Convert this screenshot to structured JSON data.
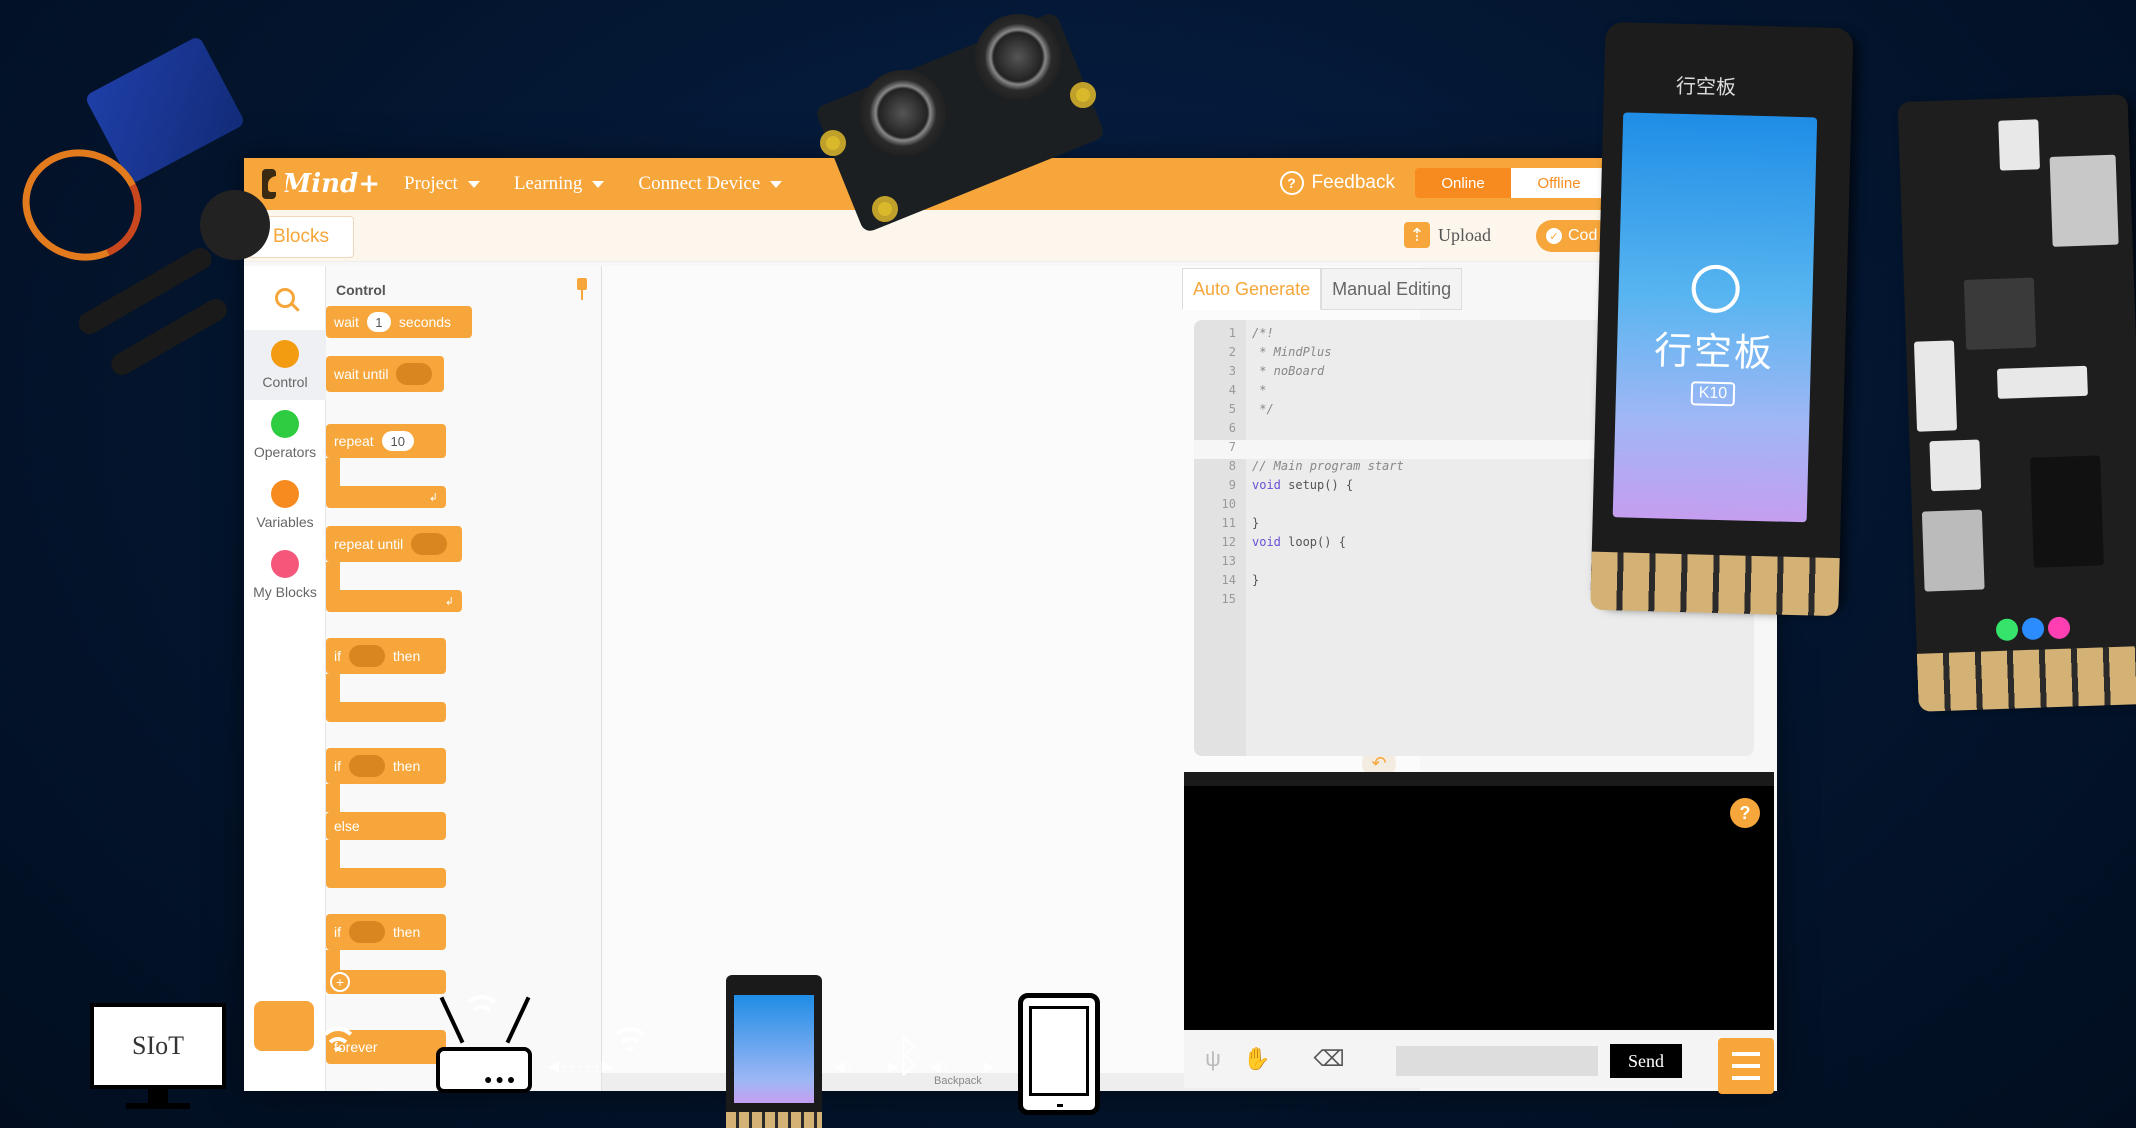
{
  "app": {
    "logo_text": "Mind+",
    "menu": [
      {
        "label": "Project"
      },
      {
        "label": "Learning"
      },
      {
        "label": "Connect Device"
      }
    ],
    "feedback_label": "Feedback",
    "mode_online": "Online",
    "mode_offline": "Offline",
    "accent_color": "#f6a63a"
  },
  "toolbar": {
    "blocks_tab": "Blocks",
    "upload_label": "Upload",
    "code_button": "Cod"
  },
  "categories": [
    {
      "label": "Control",
      "color": "#f39c12"
    },
    {
      "label": "Operators",
      "color": "#2ecc40"
    },
    {
      "label": "Variables",
      "color": "#f78b1f"
    },
    {
      "label": "My Blocks",
      "color": "#f5577a"
    }
  ],
  "palette": {
    "title": "Control",
    "wait_prefix": "wait",
    "wait_value": "1",
    "wait_suffix": "seconds",
    "wait_until": "wait until",
    "repeat": "repeat",
    "repeat_value": "10",
    "repeat_until": "repeat until",
    "if_label": "if",
    "then_label": "then",
    "else_label": "else",
    "forever": "forever"
  },
  "workspace": {
    "backpack_label": "Backpack"
  },
  "code_panel": {
    "tab_auto": "Auto Generate",
    "tab_manual": "Manual Editing",
    "lines": [
      {
        "n": "1",
        "text": "/*!"
      },
      {
        "n": "2",
        "text": " * MindPlus"
      },
      {
        "n": "3",
        "text": " * noBoard"
      },
      {
        "n": "4",
        "text": " *"
      },
      {
        "n": "5",
        "text": " */"
      },
      {
        "n": "6",
        "text": ""
      },
      {
        "n": "7",
        "text": ""
      },
      {
        "n": "8",
        "text": "// Main program start"
      },
      {
        "n": "9",
        "text": "void setup() {"
      },
      {
        "n": "10",
        "text": ""
      },
      {
        "n": "11",
        "text": "}"
      },
      {
        "n": "12",
        "text": "void loop() {"
      },
      {
        "n": "13",
        "text": ""
      },
      {
        "n": "14",
        "text": "}"
      },
      {
        "n": "15",
        "text": ""
      }
    ]
  },
  "serial": {
    "help": "?",
    "send_label": "Send"
  },
  "hardware": {
    "k10_brand": "行空板",
    "k10_name": "行空板",
    "k10_model": "K10"
  },
  "diagram": {
    "monitor_label": "SIoT",
    "arrow": "◂·····▸"
  }
}
